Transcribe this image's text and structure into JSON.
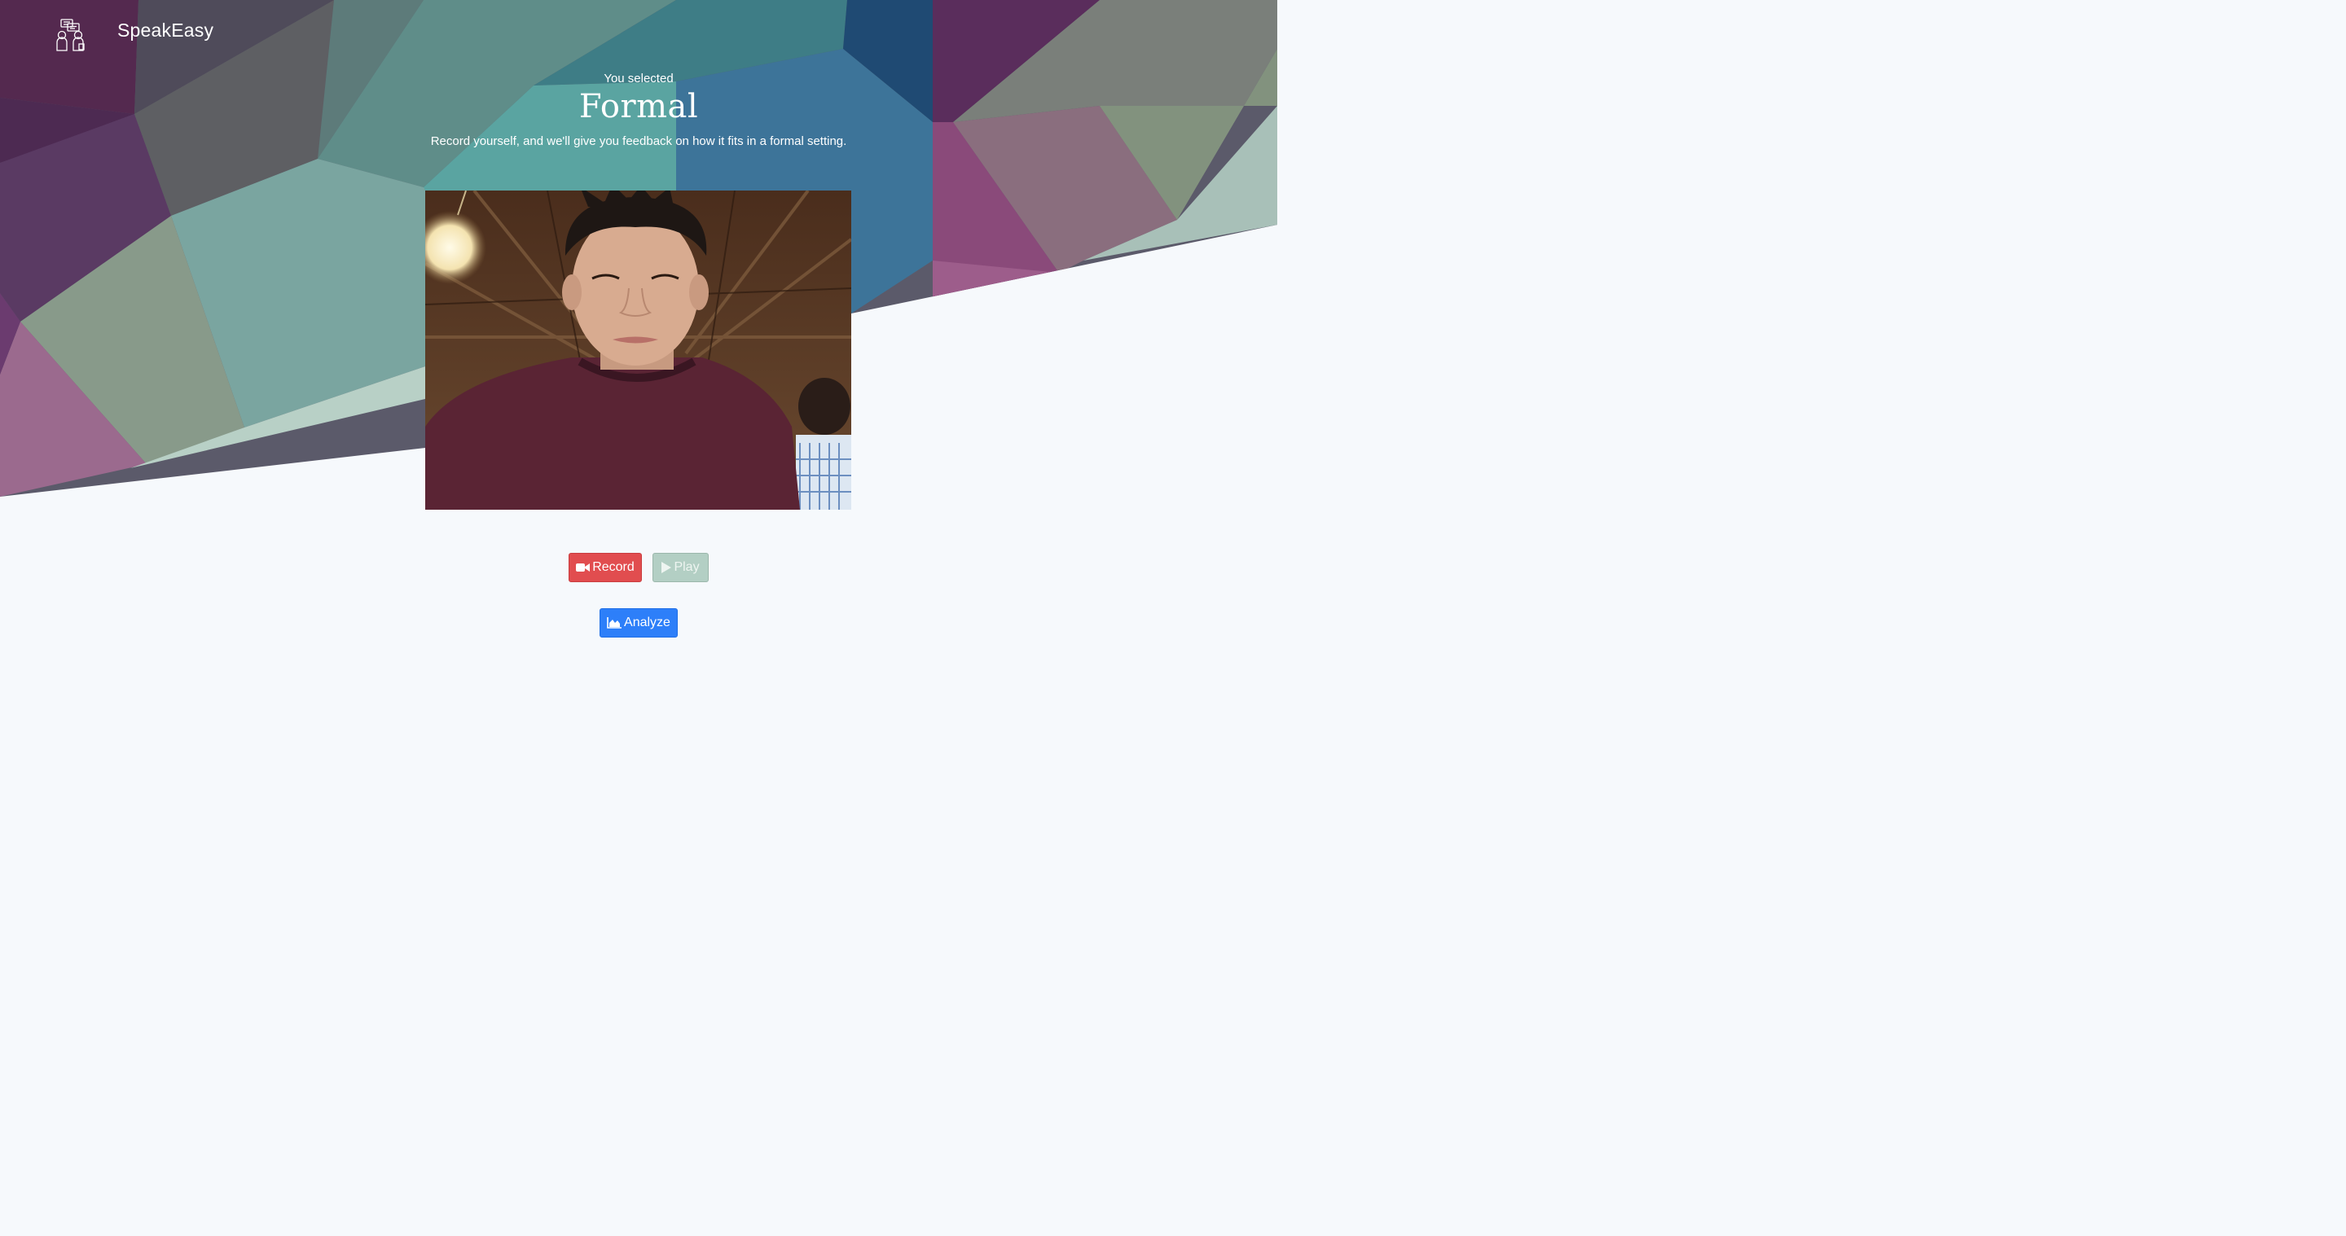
{
  "app": {
    "name": "SpeakEasy"
  },
  "hero": {
    "selected_label": "You selected",
    "mode_title": "Formal",
    "description": "Record yourself, and we'll give you feedback on how it fits in a formal setting."
  },
  "controls": {
    "record_label": "Record",
    "play_label": "Play",
    "analyze_label": "Analyze"
  },
  "icons": {
    "logo": "people-chat-icon",
    "record": "video-camera-icon",
    "play": "play-icon",
    "analyze": "area-chart-icon"
  },
  "colors": {
    "record_button": "#e14d4f",
    "play_button_disabled": "#b3cfc4",
    "analyze_button": "#2d7ff9",
    "page_background": "#f6f9fc"
  }
}
